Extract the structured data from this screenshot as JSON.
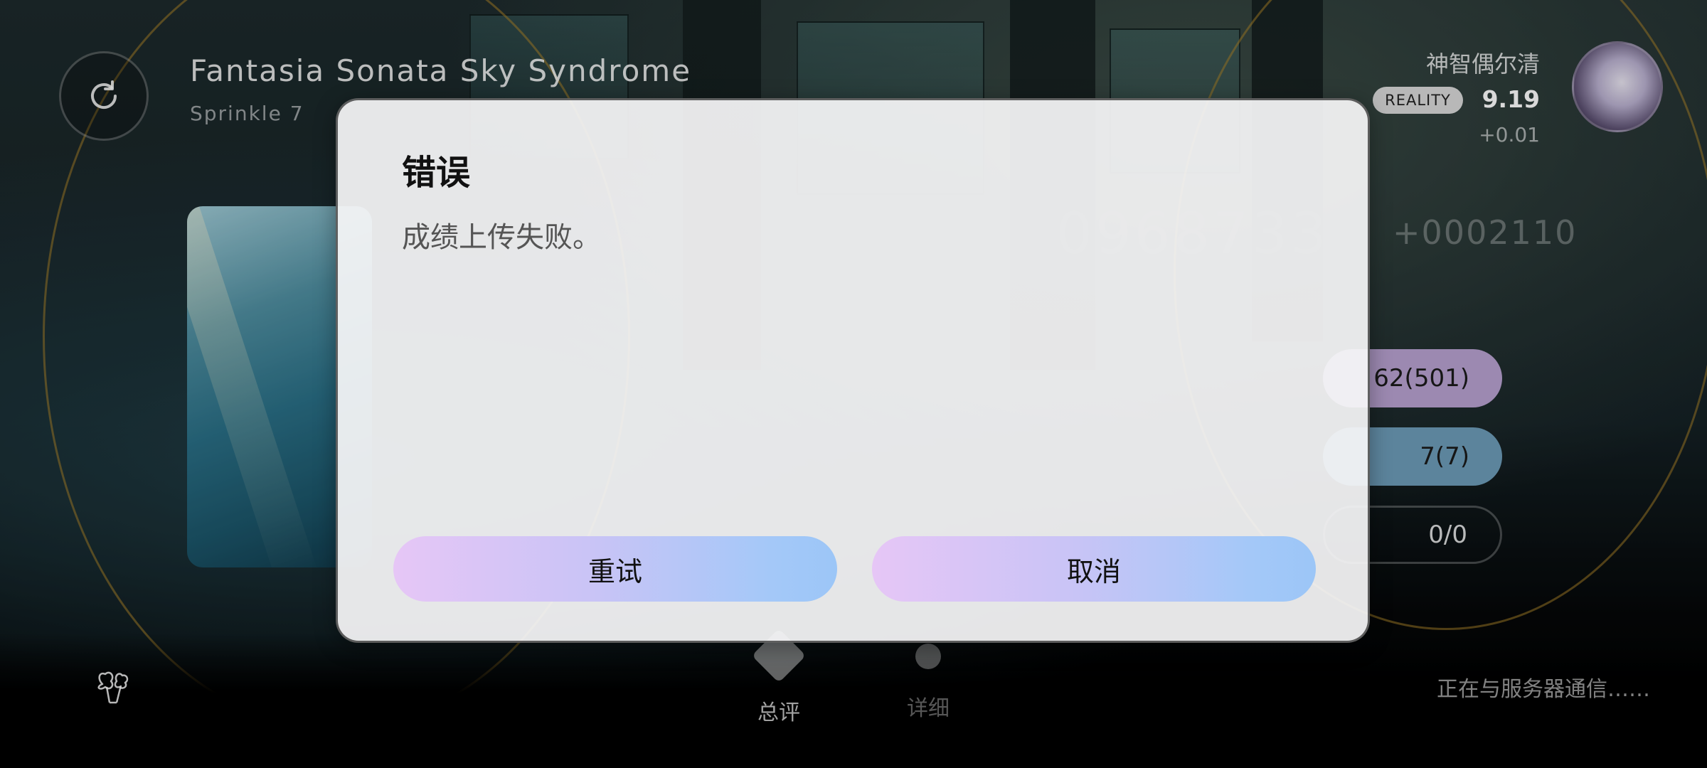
{
  "header": {
    "song_title": "Fantasia Sonata Sky Syndrome",
    "difficulty": "Sprinkle 7",
    "player_name": "神智偶尔清",
    "rank_badge": "REALITY",
    "rks": "9.19",
    "rks_delta": "+0.01"
  },
  "score": {
    "ghost": "0968733",
    "delta": "+0002110"
  },
  "judgements": {
    "perfect": "62(501)",
    "good": "7(7)",
    "bad": "0/0"
  },
  "bottom_nav": {
    "tab_summary": "总评",
    "tab_detail": "详细",
    "status": "正在与服务器通信……"
  },
  "dialog": {
    "title": "错误",
    "message": "成绩上传失败。",
    "retry_label": "重试",
    "cancel_label": "取消"
  },
  "colors": {
    "button_gradient_start": "#e6c6f6",
    "button_gradient_end": "#9cc6f7",
    "perfect_pill": "#b8a2d0",
    "good_pill": "#6d9cb8",
    "rank_badge_bg": "#d9d9d9"
  },
  "icons": {
    "retry": "retry-icon",
    "flower": "flower-icon",
    "avatar": "avatar"
  }
}
